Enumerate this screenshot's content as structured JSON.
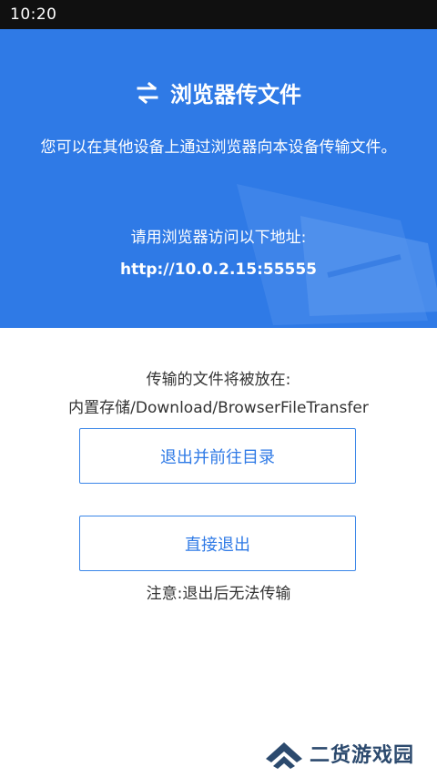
{
  "status_bar": {
    "time": "10:20"
  },
  "header": {
    "title": "浏览器传文件",
    "description": "您可以在其他设备上通过浏览器向本设备传输文件。",
    "prompt": "请用浏览器访问以下地址:",
    "address": "http://10.0.2.15:55555"
  },
  "info": {
    "label": "传输的文件将被放在:",
    "path": "内置存储/Download/BrowserFileTransfer"
  },
  "buttons": {
    "exit_to_dir": "退出并前往目录",
    "exit": "直接退出"
  },
  "note": "注意:退出后无法传输",
  "watermark": {
    "text": "二货游戏园"
  },
  "colors": {
    "accent": "#2f7ae6",
    "button_border": "#3a86e8",
    "text": "#333333"
  }
}
